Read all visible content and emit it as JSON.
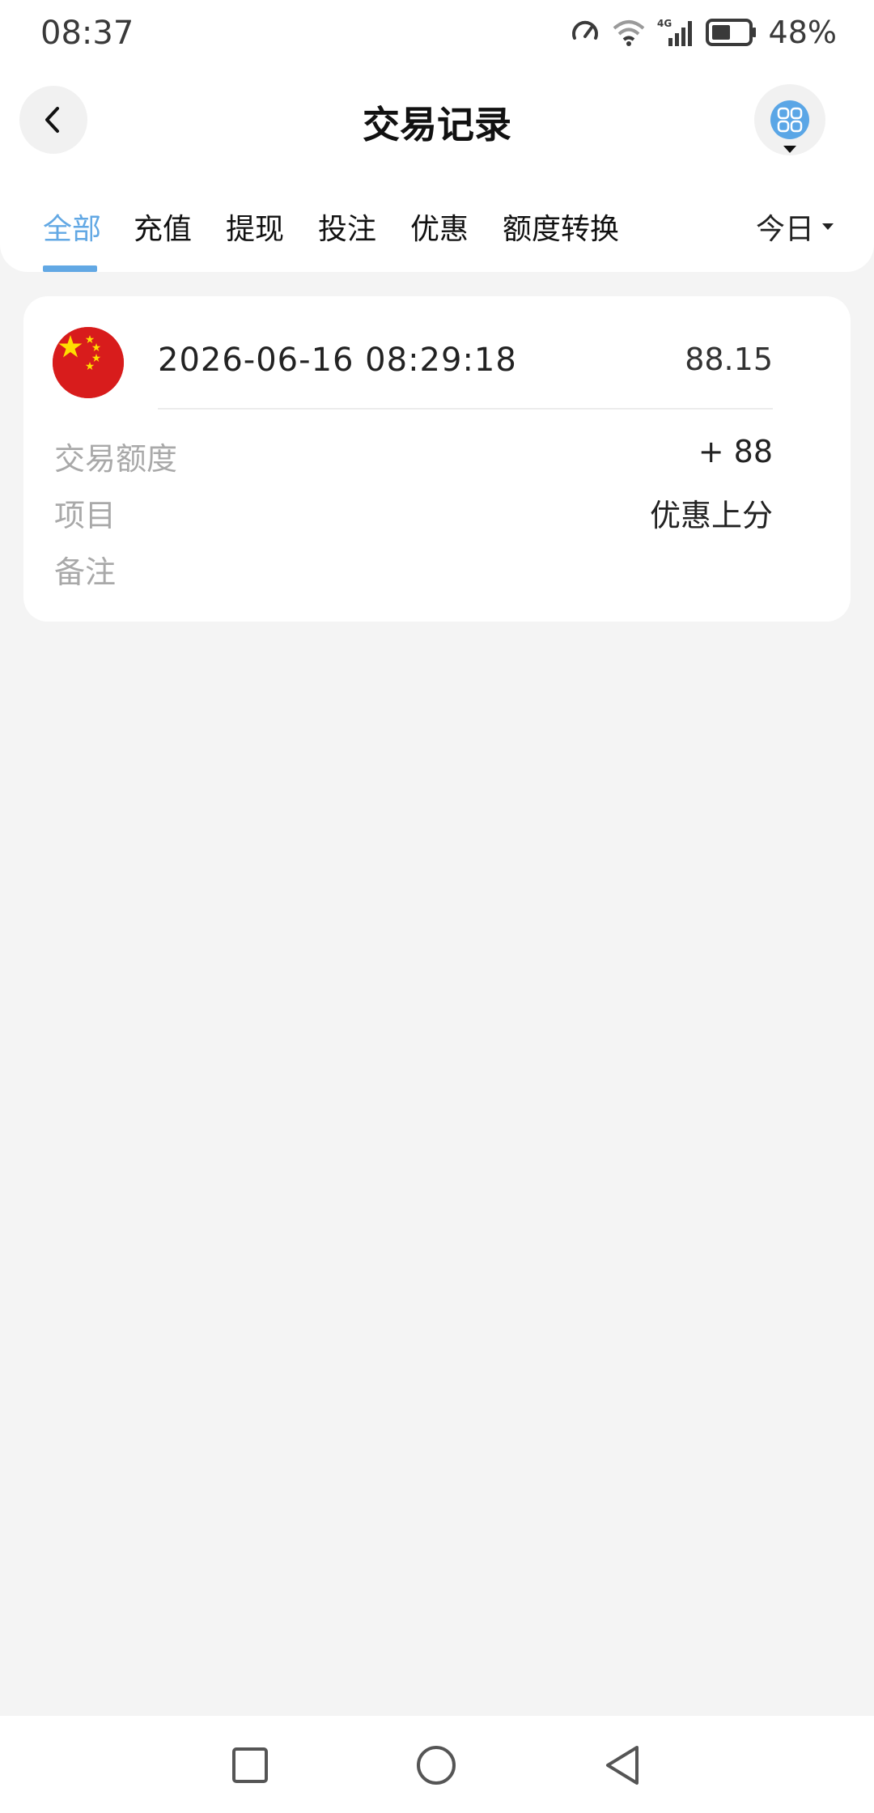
{
  "status_bar": {
    "time": "08:37",
    "network": "4G",
    "battery": "48%"
  },
  "header": {
    "title": "交易记录"
  },
  "tabs": [
    {
      "label": "全部",
      "active": true
    },
    {
      "label": "充值",
      "active": false
    },
    {
      "label": "提现",
      "active": false
    },
    {
      "label": "投注",
      "active": false
    },
    {
      "label": "优惠",
      "active": false
    },
    {
      "label": "额度转换",
      "active": false
    }
  ],
  "period_filter": {
    "label": "今日"
  },
  "records": [
    {
      "datetime": "2026-06-16 08:29:18",
      "amount": "88.15",
      "fields": {
        "amount_label": "交易额度",
        "amount_value": "+ 88",
        "item_label": "项目",
        "item_value": "优惠上分",
        "note_label": "备注",
        "note_value": ""
      }
    }
  ],
  "icons": {
    "back": "back-arrow-icon",
    "menu": "grid-menu-icon",
    "flag": "china-flag-icon",
    "nav": [
      "recent-apps-icon",
      "home-icon",
      "back-triangle-icon"
    ]
  },
  "colors": {
    "accent": "#62a8e4",
    "background": "#f4f4f4",
    "label_gray": "#a9a9a9"
  }
}
